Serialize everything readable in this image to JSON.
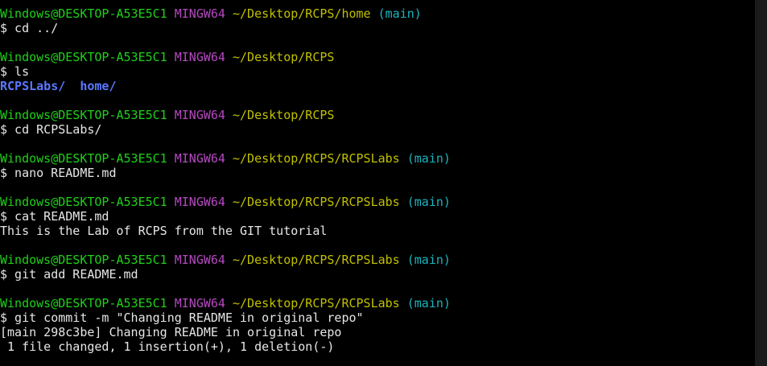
{
  "prompt": {
    "user": "Windows@DESKTOP-A53E5C1",
    "host": "MINGW64"
  },
  "blocks": [
    {
      "path": "~/Desktop/RCPS/home",
      "branch": "(main)",
      "command": "$ cd ../",
      "output": []
    },
    {
      "path": "~/Desktop/RCPS",
      "branch": "",
      "command": "$ ls",
      "dirs": [
        "RCPSLabs/",
        "home/"
      ],
      "output": []
    },
    {
      "path": "~/Desktop/RCPS",
      "branch": "",
      "command": "$ cd RCPSLabs/",
      "output": []
    },
    {
      "path": "~/Desktop/RCPS/RCPSLabs",
      "branch": "(main)",
      "command": "$ nano README.md",
      "output": []
    },
    {
      "path": "~/Desktop/RCPS/RCPSLabs",
      "branch": "(main)",
      "command": "$ cat README.md",
      "output": [
        "This is the Lab of RCPS from the GIT tutorial"
      ]
    },
    {
      "path": "~/Desktop/RCPS/RCPSLabs",
      "branch": "(main)",
      "command": "$ git add README.md",
      "output": []
    },
    {
      "path": "~/Desktop/RCPS/RCPSLabs",
      "branch": "(main)",
      "command": "$ git commit -m \"Changing README in original repo\"",
      "output": [
        "[main 298c3be] Changing README in original repo",
        " 1 file changed, 1 insertion(+), 1 deletion(-)"
      ]
    }
  ]
}
